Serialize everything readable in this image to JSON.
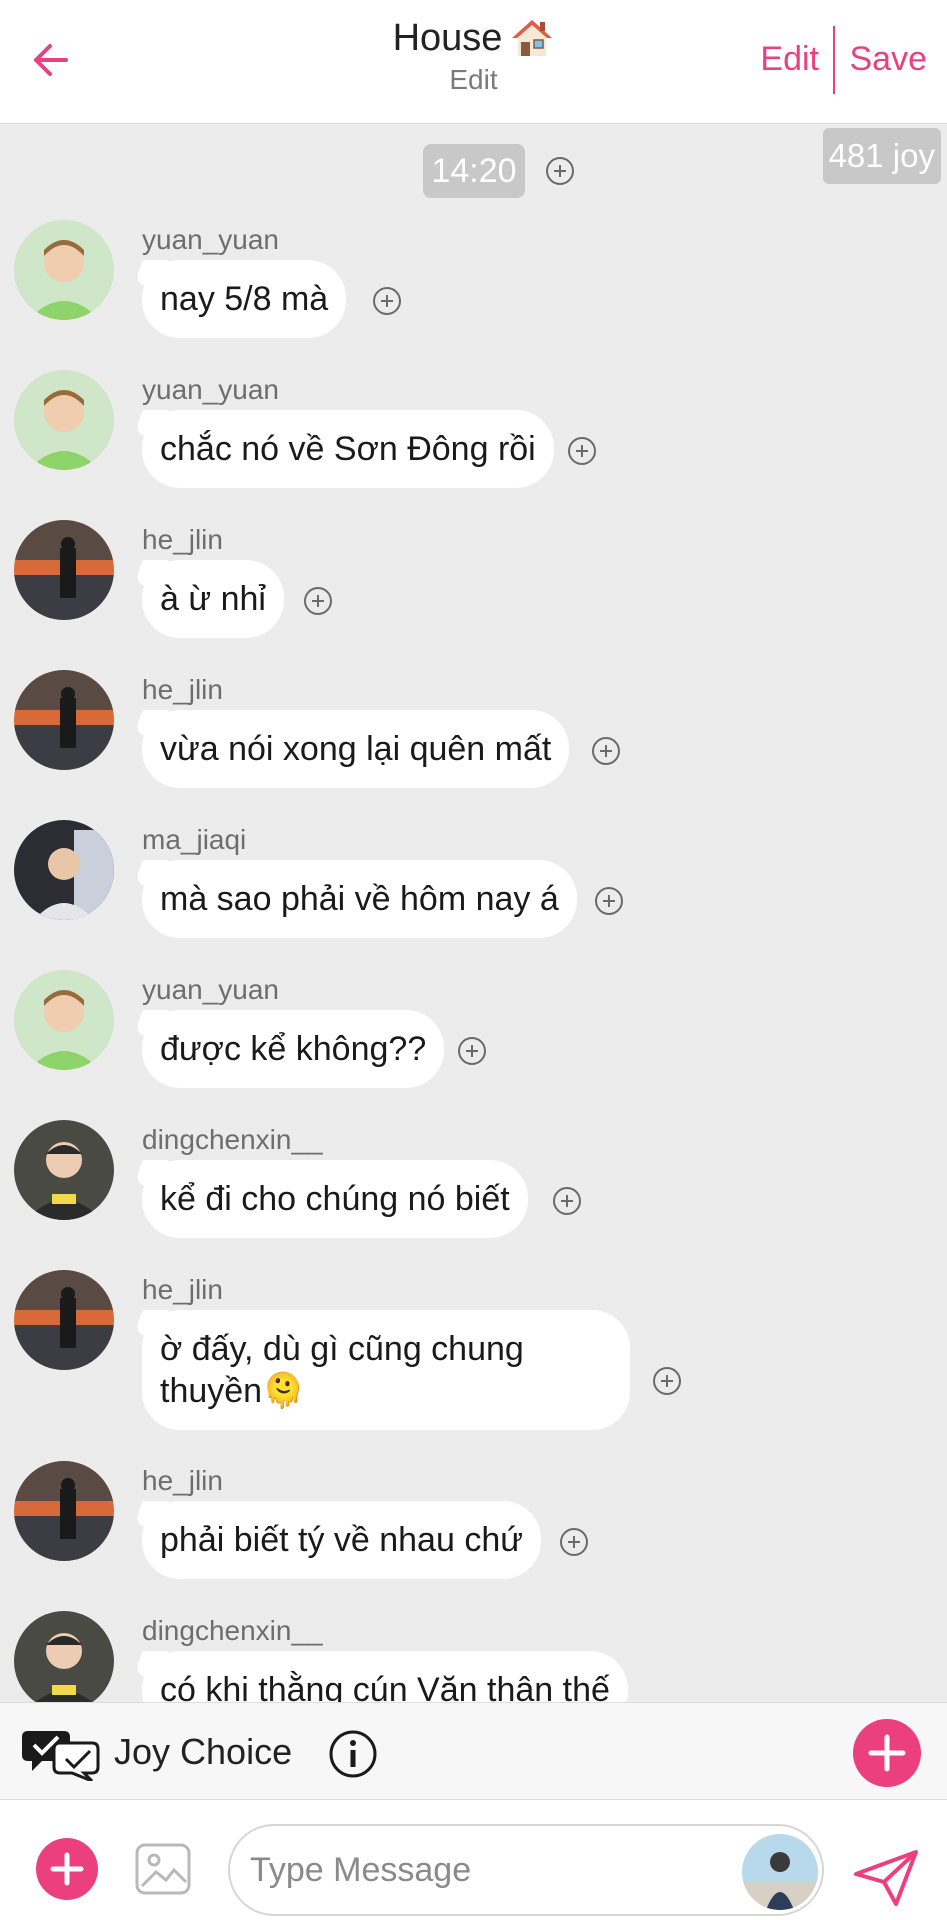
{
  "header": {
    "title": "House",
    "subtitle": "Edit",
    "edit_label": "Edit",
    "save_label": "Save",
    "accent": "#e8417f"
  },
  "chat": {
    "time": "14:20",
    "joy_count": "481 joy",
    "messages": [
      {
        "user": "yuan_yuan",
        "text": "nay 5/8 mà"
      },
      {
        "user": "yuan_yuan",
        "text": "chắc nó về Sơn Đông rồi"
      },
      {
        "user": "he_jlin",
        "text": "à ừ nhỉ"
      },
      {
        "user": "he_jlin",
        "text": "vừa nói xong lại quên mất"
      },
      {
        "user": "ma_jiaqi",
        "text": "mà sao phải về hôm nay á"
      },
      {
        "user": "yuan_yuan",
        "text": "được kể không??"
      },
      {
        "user": "dingchenxin__",
        "text": "kể đi cho chúng nó biết"
      },
      {
        "user": "he_jlin",
        "text": "ờ đấy, dù gì cũng chung thuyền🫠"
      },
      {
        "user": "he_jlin",
        "text": "phải biết tý về nhau chứ"
      },
      {
        "user": "dingchenxin__",
        "text": "có khi thằng cún Văn thân thế"
      }
    ]
  },
  "joy_choice": {
    "label": "Joy Choice"
  },
  "composer": {
    "placeholder": "Type Message"
  },
  "icons": {
    "back": "arrow-left-icon",
    "house": "house-emoji-icon",
    "plus": "plus-circle-icon",
    "joy": "chat-check-icon",
    "info": "info-icon",
    "image": "image-icon",
    "send": "send-icon"
  }
}
